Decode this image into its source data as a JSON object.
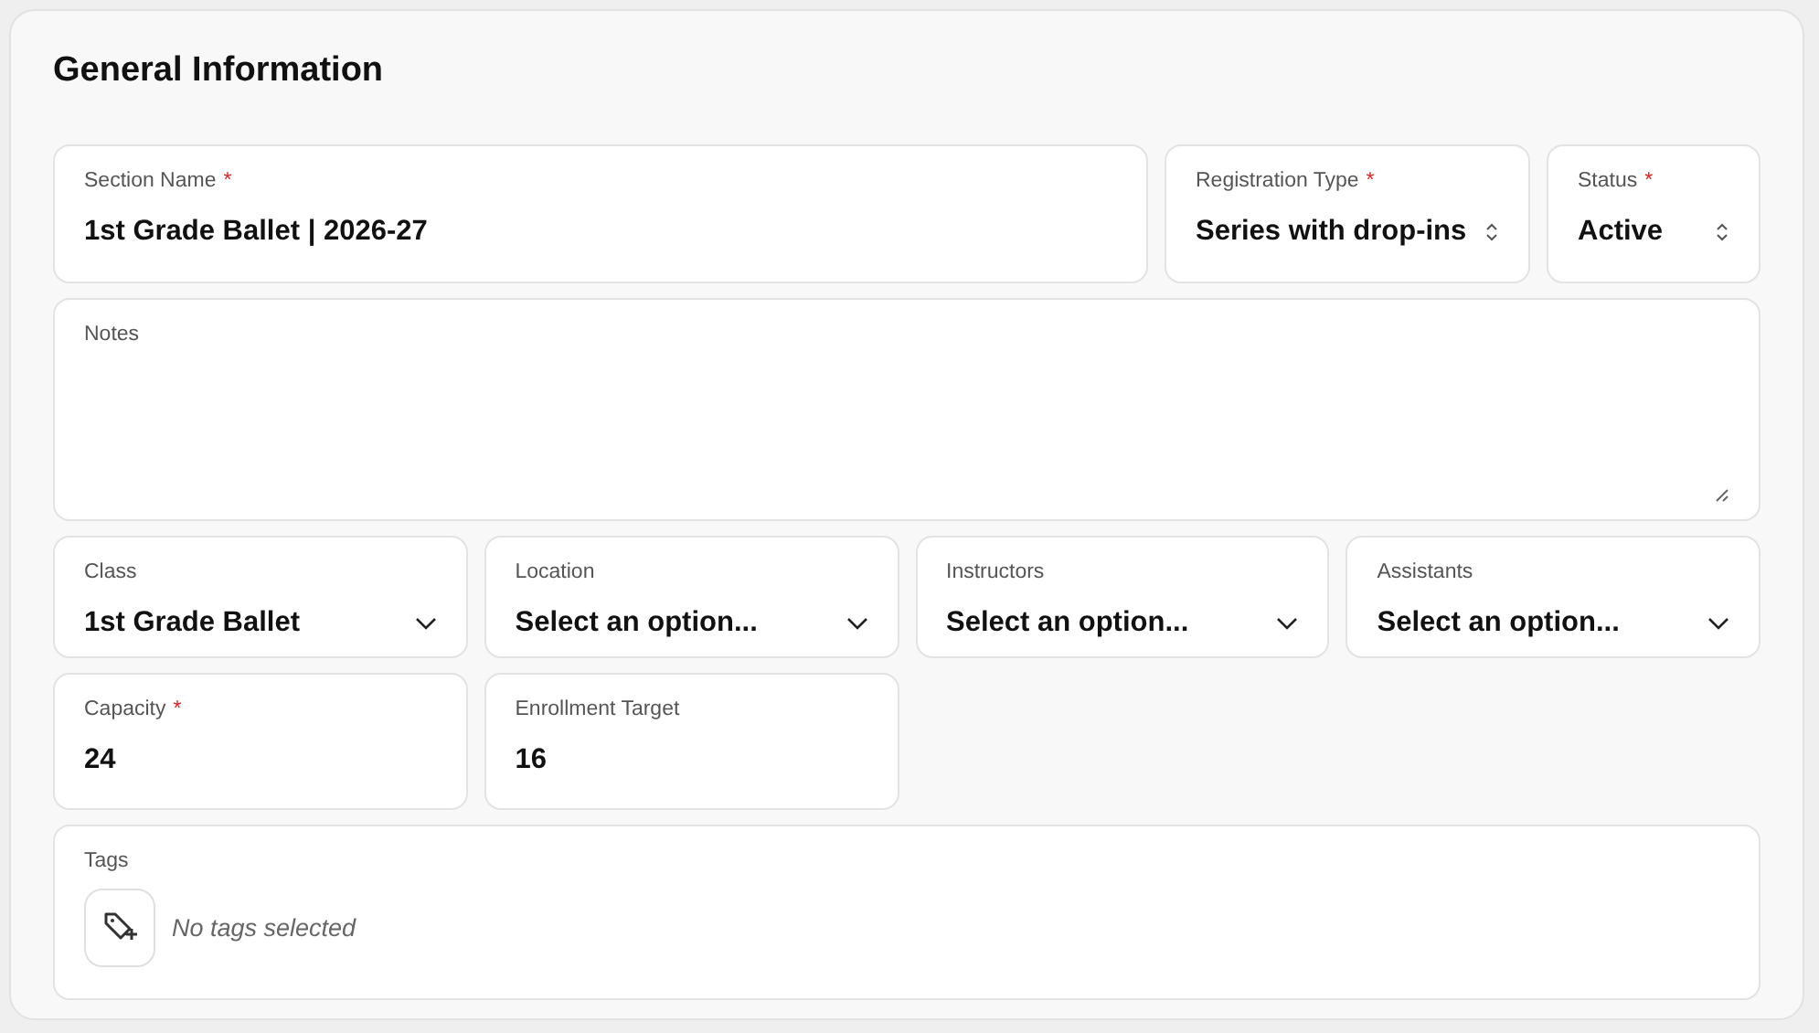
{
  "title": "General Information",
  "rows": [
    [
      {
        "kind": "text",
        "label": "Section Name",
        "required_mark": "*",
        "value": "1st Grade Ballet | 2026-27"
      },
      {
        "kind": "stepper",
        "label": "Registration Type",
        "required_mark": "*",
        "value": "Series with drop-ins"
      },
      {
        "kind": "stepper",
        "label": "Status",
        "required_mark": "*",
        "value": "Active"
      }
    ],
    [
      {
        "kind": "textarea",
        "label": "Notes"
      }
    ],
    [
      {
        "kind": "select",
        "label": "Class",
        "value": "1st Grade Ballet"
      },
      {
        "kind": "select",
        "label": "Location",
        "value": "Select an option..."
      },
      {
        "kind": "select",
        "label": "Instructors",
        "value": "Select an option..."
      },
      {
        "kind": "select",
        "label": "Assistants",
        "value": "Select an option..."
      }
    ],
    [
      {
        "kind": "text",
        "label": "Capacity",
        "required_mark": "*",
        "value": "24"
      },
      {
        "kind": "text",
        "label": "Enrollment Target",
        "value": "16"
      }
    ],
    [
      {
        "kind": "tags",
        "label": "Tags",
        "empty_text": "No tags selected"
      }
    ]
  ]
}
